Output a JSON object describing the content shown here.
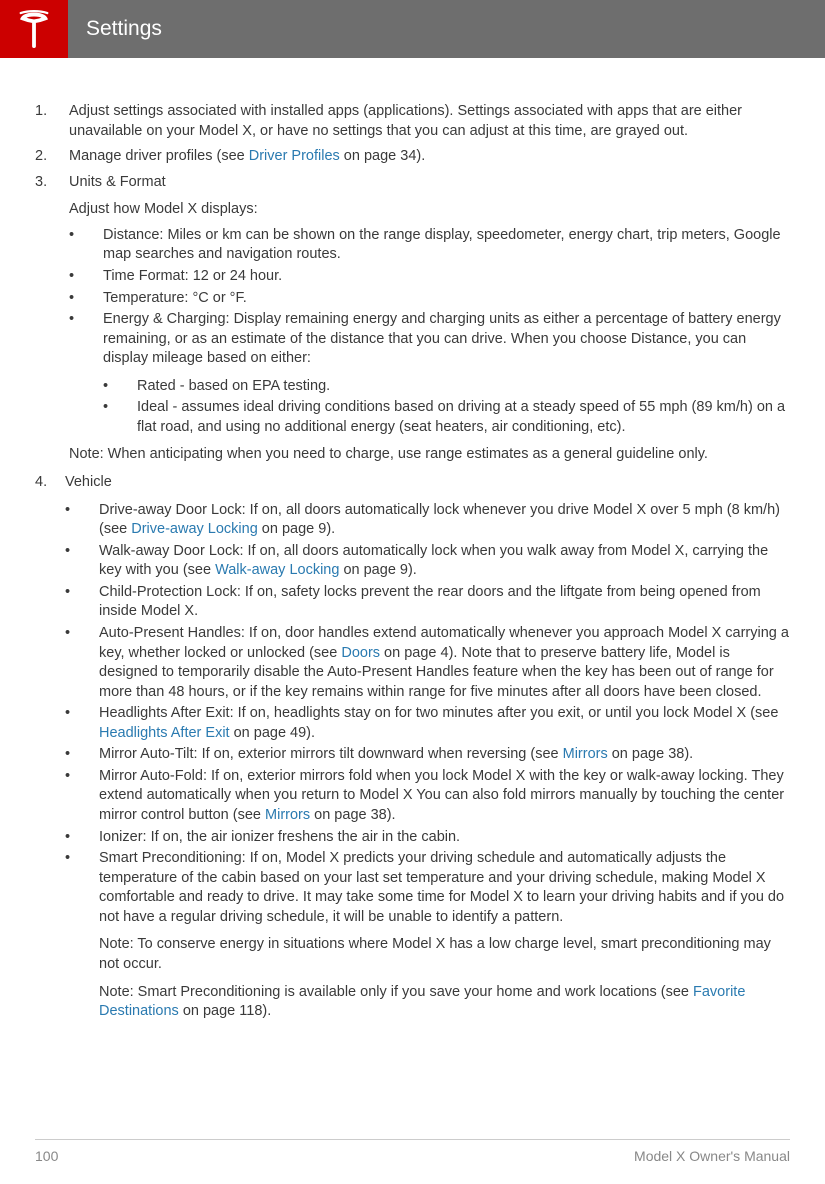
{
  "header": {
    "title": "Settings"
  },
  "items": {
    "i1": "Adjust settings associated with installed apps (applications). Settings associated with apps that are either unavailable on your Model X, or have no settings that you can adjust at this time, are grayed out.",
    "i2a": "Manage driver profiles (see ",
    "i2link": "Driver Profiles",
    "i2b": " on page 34).",
    "i3": "Units & Format",
    "i3intro": "Adjust how Model X displays:",
    "i3_1": "Distance: Miles or km can be shown on the range display, speedometer, energy chart, trip meters, Google map searches and navigation routes.",
    "i3_2": "Time Format: 12 or 24 hour.",
    "i3_3": "Temperature: °C or °F.",
    "i3_4": "Energy & Charging: Display remaining energy and charging units as either a percentage of battery energy remaining, or as an estimate of the distance that you can drive. When you choose Distance, you can display mileage based on either:",
    "i3_4a": "Rated - based on EPA testing.",
    "i3_4b": "Ideal - assumes ideal driving conditions based on driving at a steady speed of 55 mph (89 km/h) on a flat road, and using no additional energy (seat heaters, air conditioning, etc).",
    "i3note": "Note: When anticipating when you need to charge, use range estimates as a general guideline only.",
    "i4": "Vehicle",
    "i4_1a": "Drive-away Door Lock: If on, all doors automatically lock whenever you drive Model X over 5 mph (8 km/h) (see ",
    "i4_1link": "Drive-away Locking",
    "i4_1b": " on page 9).",
    "i4_2a": "Walk-away Door Lock: If on, all doors automatically lock when you walk away from Model X, carrying the key with you (see ",
    "i4_2link": "Walk-away Locking",
    "i4_2b": " on page 9).",
    "i4_3": "Child-Protection Lock: If on, safety locks prevent the rear doors and the liftgate from being opened from inside Model X.",
    "i4_4a": "Auto-Present Handles: If on, door handles extend automatically whenever you approach Model X carrying a key, whether locked or unlocked (see ",
    "i4_4link": "Doors",
    "i4_4b": " on page 4). Note that to preserve battery life, Model is designed to temporarily disable the Auto-Present Handles feature when the key has been out of range for more than 48 hours, or if the key remains within range for five minutes after all doors have been closed.",
    "i4_5a": "Headlights After Exit: If on, headlights stay on for two minutes after you exit, or until you lock Model X (see ",
    "i4_5link": "Headlights After Exit",
    "i4_5b": " on page 49).",
    "i4_6a": "Mirror Auto-Tilt: If on, exterior mirrors tilt downward when reversing (see ",
    "i4_6link": "Mirrors",
    "i4_6b": " on page 38).",
    "i4_7a": "Mirror Auto-Fold: If on, exterior mirrors fold when you lock Model X with the key or walk-away locking. They extend automatically when you return to Model X You can also fold mirrors manually by touching the center mirror control button (see ",
    "i4_7link": "Mirrors",
    "i4_7b": " on page 38).",
    "i4_8": "Ionizer: If on, the air ionizer freshens the air in the cabin.",
    "i4_9": "Smart Preconditioning: If on, Model X predicts your driving schedule and automatically adjusts the temperature of the cabin based on your last set temperature and your driving schedule, making Model X comfortable and ready to drive. It may take some time for Model X to learn your driving habits and if you do not have a regular driving schedule, it will be unable to identify a pattern.",
    "i4_9note1": "Note: To conserve energy in situations where Model X has a low charge level, smart preconditioning may not occur.",
    "i4_9note2a": "Note: Smart Preconditioning is available only if you save your home and work locations (see ",
    "i4_9note2link": "Favorite Destinations",
    "i4_9note2b": " on page 118)."
  },
  "footer": {
    "page": "100",
    "title": "Model X Owner's Manual"
  }
}
